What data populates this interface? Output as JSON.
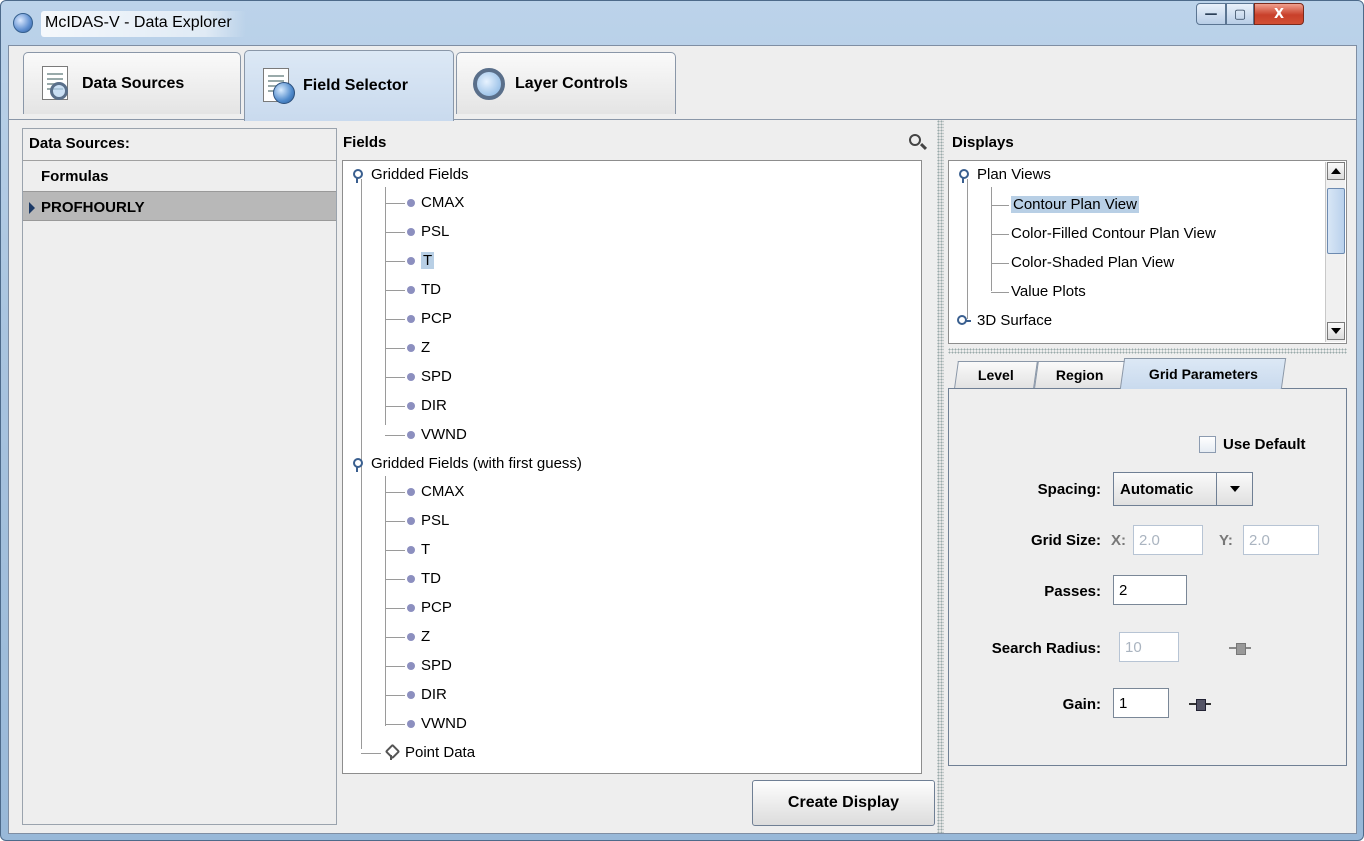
{
  "window": {
    "title": "McIDAS-V - Data Explorer",
    "min": "—",
    "max": "▢",
    "close": "X"
  },
  "tabs": [
    {
      "label": "Data Sources",
      "icon": "document-search-icon"
    },
    {
      "label": "Field Selector",
      "icon": "document-globe-icon"
    },
    {
      "label": "Layer Controls",
      "icon": "magnifier-icon"
    }
  ],
  "active_tab": "Field Selector",
  "data_sources": {
    "title": "Data Sources:",
    "items": [
      {
        "label": "Formulas",
        "selected": false
      },
      {
        "label": "PROFHOURLY",
        "selected": true
      }
    ]
  },
  "fields": {
    "title": "Fields",
    "groups": [
      {
        "label": "Gridded Fields",
        "items": [
          "CMAX",
          "PSL",
          "T",
          "TD",
          "PCP",
          "Z",
          "SPD",
          "DIR",
          "VWND"
        ],
        "selected": "T"
      },
      {
        "label": "Gridded Fields (with first guess)",
        "items": [
          "CMAX",
          "PSL",
          "T",
          "TD",
          "PCP",
          "Z",
          "SPD",
          "DIR",
          "VWND"
        ]
      }
    ],
    "point_data": "Point Data"
  },
  "displays": {
    "title": "Displays",
    "group": "Plan Views",
    "items": [
      "Contour Plan View",
      "Color-Filled Contour Plan View",
      "Color-Shaded Plan View",
      "Value Plots"
    ],
    "selected": "Contour Plan View",
    "next_group": "3D Surface"
  },
  "settings": {
    "tabs": [
      "Level",
      "Region",
      "Grid Parameters"
    ],
    "active_tab": "Grid Parameters",
    "use_default": "Use Default",
    "spacing_label": "Spacing:",
    "spacing_value": "Automatic",
    "grid_size_label": "Grid Size:",
    "x_label": "X:",
    "x_value": "2.0",
    "y_label": "Y:",
    "y_value": "2.0",
    "passes_label": "Passes:",
    "passes_value": "2",
    "search_radius_label": "Search Radius:",
    "search_radius_value": "10",
    "gain_label": "Gain:",
    "gain_value": "1"
  },
  "create_display": "Create Display"
}
